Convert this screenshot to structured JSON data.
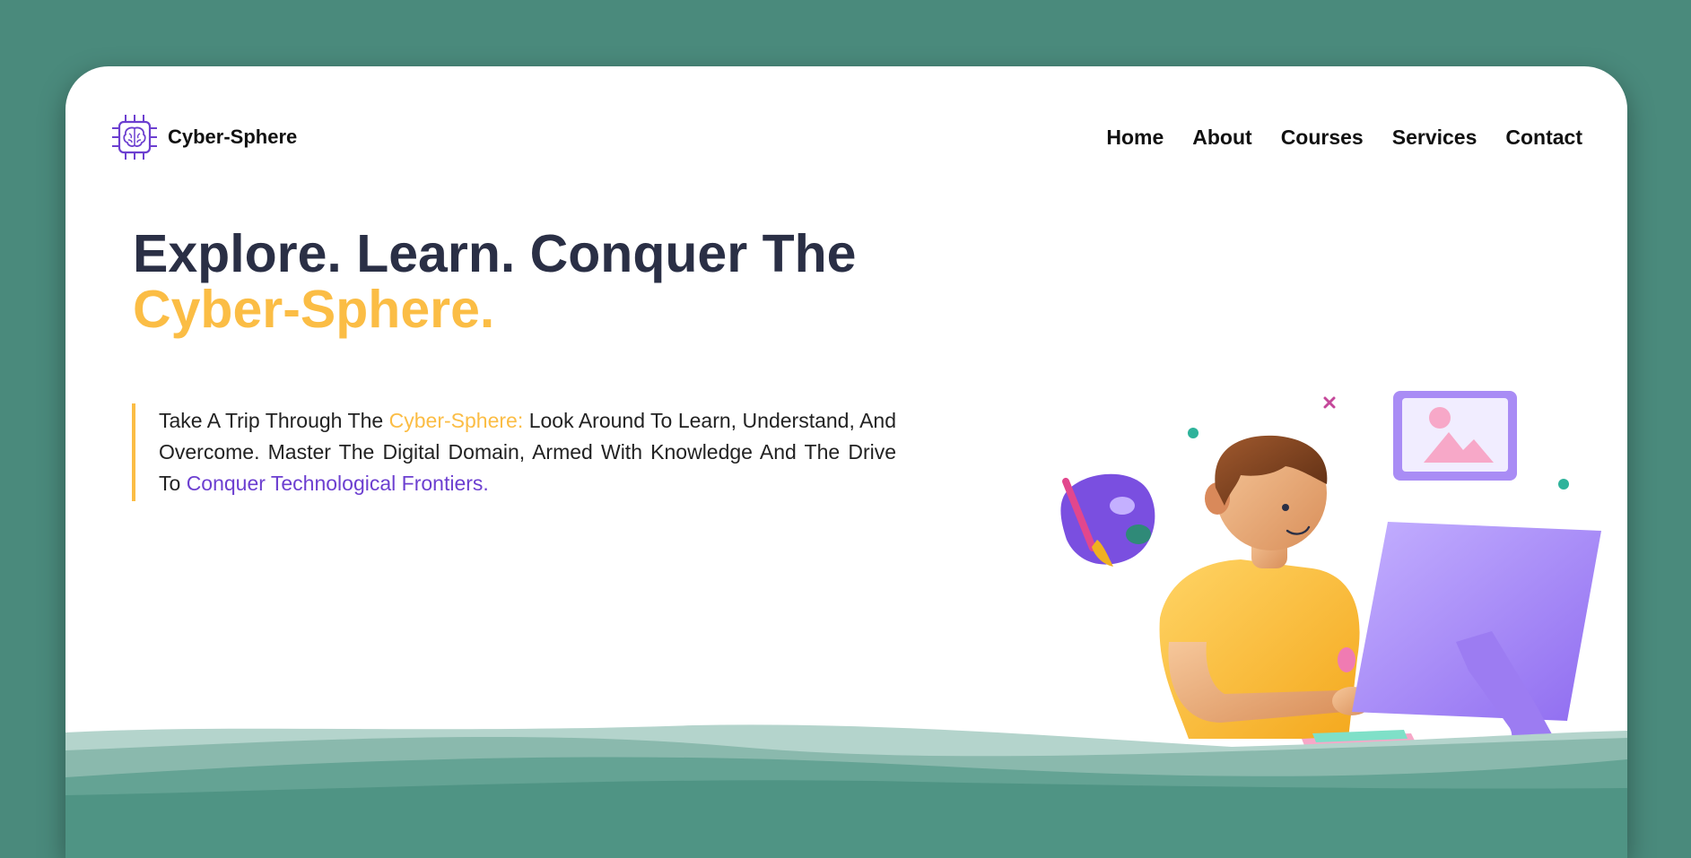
{
  "brand": {
    "name": "Cyber-Sphere",
    "icon": "brain-chip-icon"
  },
  "nav": {
    "items": [
      {
        "label": "Home"
      },
      {
        "label": "About"
      },
      {
        "label": "Courses"
      },
      {
        "label": "Services"
      },
      {
        "label": "Contact"
      }
    ]
  },
  "hero": {
    "headline_line1": "Explore. Learn. Conquer The",
    "headline_line2": "Cyber-Sphere.",
    "intro": {
      "part1": "Take A Trip Through The ",
      "highlight1": "Cyber-Sphere:",
      "part2": " Look Around To Learn, Understand, And Overcome. Master The Digital Domain, Armed With Knowledge And The Drive To ",
      "highlight2": "Conquer Technological Frontiers."
    },
    "illustration": "person-at-computer-illustration"
  },
  "colors": {
    "background": "#4a8a7c",
    "accent_yellow": "#fbbd45",
    "accent_purple": "#6c3fd0",
    "heading": "#2a2f45"
  }
}
